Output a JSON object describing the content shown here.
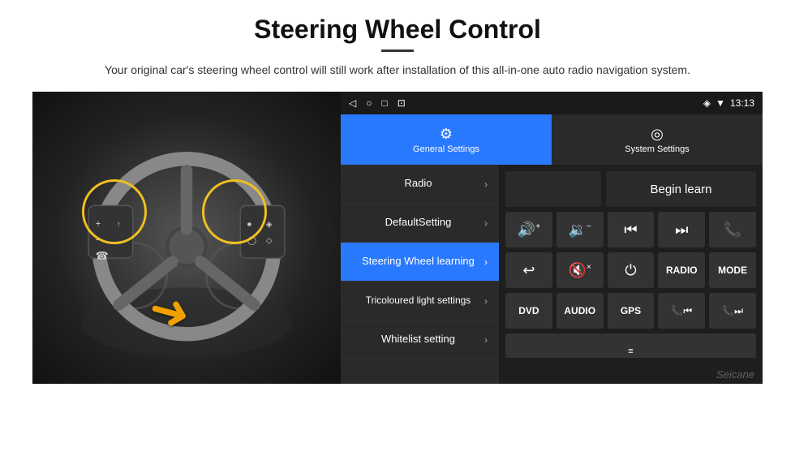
{
  "page": {
    "title": "Steering Wheel Control",
    "subtitle": "Your original car's steering wheel control will still work after installation of this all-in-one auto radio navigation system.",
    "divider": "—"
  },
  "status_bar": {
    "time": "13:13",
    "icons": [
      "◁",
      "○",
      "□",
      "⊡"
    ],
    "right_icons": [
      "♥",
      "▼"
    ]
  },
  "nav_tabs": [
    {
      "id": "general",
      "icon": "⚙",
      "label": "General Settings",
      "active": true
    },
    {
      "id": "system",
      "icon": "◎",
      "label": "System Settings",
      "active": false
    }
  ],
  "menu_items": [
    {
      "id": "radio",
      "label": "Radio",
      "active": false
    },
    {
      "id": "default",
      "label": "DefaultSetting",
      "active": false
    },
    {
      "id": "steering",
      "label": "Steering Wheel learning",
      "active": true
    },
    {
      "id": "tricoloured",
      "label": "Tricoloured light settings",
      "active": false
    },
    {
      "id": "whitelist",
      "label": "Whitelist setting",
      "active": false
    }
  ],
  "right_panel": {
    "begin_learn_label": "Begin learn",
    "buttons_row1": [
      {
        "id": "vol-up",
        "icon": "🔊+",
        "unicode": "🔊"
      },
      {
        "id": "vol-down",
        "icon": "🔉-",
        "unicode": "🔉"
      },
      {
        "id": "prev-track",
        "icon": "⏮",
        "unicode": "⏮"
      },
      {
        "id": "next-track",
        "icon": "⏭",
        "unicode": "⏭"
      },
      {
        "id": "phone",
        "icon": "📞",
        "unicode": "📞"
      }
    ],
    "buttons_row2": [
      {
        "id": "hangup",
        "icon": "📵",
        "unicode": "↩"
      },
      {
        "id": "mute",
        "icon": "🔇×",
        "unicode": "🔇"
      },
      {
        "id": "power",
        "icon": "⏻",
        "unicode": "⏻"
      },
      {
        "id": "radio-btn",
        "label": "RADIO",
        "is_text": true
      },
      {
        "id": "mode-btn",
        "label": "MODE",
        "is_text": true
      }
    ],
    "buttons_row3": [
      {
        "id": "dvd-btn",
        "label": "DVD",
        "is_text": true
      },
      {
        "id": "audio-btn",
        "label": "AUDIO",
        "is_text": true
      },
      {
        "id": "gps-btn",
        "label": "GPS",
        "is_text": true
      },
      {
        "id": "tel-prev",
        "icon": "📞⏮",
        "unicode": "📞"
      },
      {
        "id": "tel-next",
        "icon": "📞⏭",
        "unicode": "📞"
      }
    ],
    "partial_row": [
      {
        "id": "partial-icon",
        "icon": "≡",
        "unicode": "≡"
      }
    ]
  },
  "watermark": "Seicane"
}
